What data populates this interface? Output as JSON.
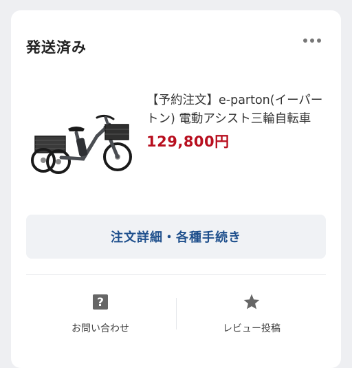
{
  "order": {
    "status": "発送済み",
    "more_icon": "more-horizontal-icon"
  },
  "product": {
    "title": "【予約注文】e-parton(イーパートン) 電動アシスト三輪自転車",
    "price": "129,800円",
    "image": "electric-assist-tricycle"
  },
  "actions": {
    "details_label": "注文詳細・各種手続き",
    "inquiry_label": "お問い合わせ",
    "inquiry_icon": "question-mark-icon",
    "review_label": "レビュー投稿",
    "review_icon": "star-icon"
  },
  "colors": {
    "price": "#b80f1f",
    "details_text": "#1e4f8c",
    "icon": "#666666"
  }
}
